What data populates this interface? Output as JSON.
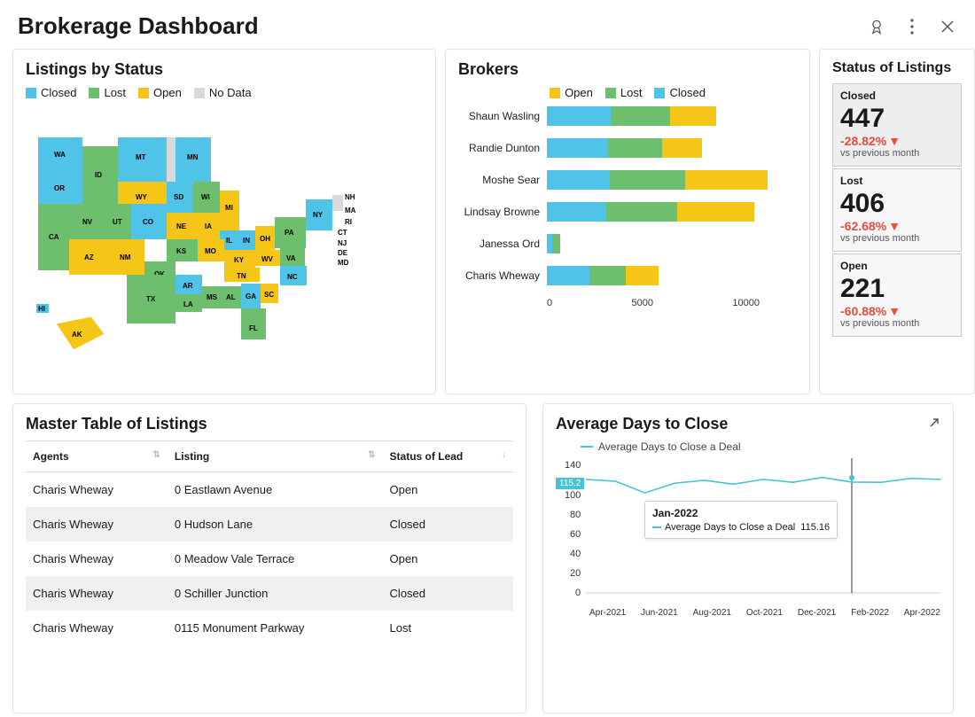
{
  "header": {
    "title": "Brokerage Dashboard"
  },
  "colors": {
    "closed": "#4fc3e8",
    "lost": "#6dbf6d",
    "open": "#f5c518",
    "nodata": "#d9d9d9"
  },
  "map": {
    "title": "Listings by Status",
    "legend": [
      {
        "label": "Closed",
        "color": "#4fc3e8"
      },
      {
        "label": "Lost",
        "color": "#6dbf6d"
      },
      {
        "label": "Open",
        "color": "#f5c518"
      },
      {
        "label": "No Data",
        "color": "#d9d9d9"
      }
    ]
  },
  "brokers": {
    "title": "Brokers",
    "legend": [
      {
        "label": "Open",
        "color": "#f5c518"
      },
      {
        "label": "Lost",
        "color": "#6dbf6d"
      },
      {
        "label": "Closed",
        "color": "#4fc3e8"
      }
    ]
  },
  "chart_data": [
    {
      "type": "bar",
      "title": "Brokers",
      "orientation": "horizontal",
      "stacked": true,
      "xlim": [
        0,
        14000
      ],
      "x_ticks": [
        0,
        5000,
        10000
      ],
      "categories": [
        "Shaun Wasling",
        "Randie Dunton",
        "Moshe Sear",
        "Lindsay Browne",
        "Janessa Ord",
        "Charis Wheway"
      ],
      "series": [
        {
          "name": "Closed",
          "color": "#4fc3e8",
          "values": [
            3900,
            3700,
            3800,
            3600,
            300,
            2600
          ]
        },
        {
          "name": "Lost",
          "color": "#6dbf6d",
          "values": [
            3600,
            3300,
            4600,
            4300,
            500,
            2200
          ]
        },
        {
          "name": "Open",
          "color": "#f5c518",
          "values": [
            2800,
            2400,
            5000,
            4700,
            0,
            2000
          ]
        }
      ]
    },
    {
      "type": "line",
      "title": "Average Days to Close",
      "legend": [
        "Average Days to Close a Deal"
      ],
      "x": [
        "Apr-2021",
        "May-2021",
        "Jun-2021",
        "Jul-2021",
        "Aug-2021",
        "Sep-2021",
        "Oct-2021",
        "Nov-2021",
        "Dec-2021",
        "Jan-2022",
        "Feb-2022",
        "Mar-2022",
        "Apr-2022"
      ],
      "x_ticks": [
        "Apr-2021",
        "Jun-2021",
        "Aug-2021",
        "Oct-2021",
        "Dec-2021",
        "Feb-2022",
        "Apr-2022"
      ],
      "series": [
        {
          "name": "Average Days to Close a Deal",
          "color": "#46c3d4",
          "values": [
            118,
            116,
            104,
            114,
            117,
            113,
            118,
            115,
            120,
            115.16,
            115,
            119,
            118
          ]
        }
      ],
      "ylim": [
        0,
        140
      ],
      "y_ticks": [
        0,
        20,
        40,
        60,
        80,
        100,
        140
      ],
      "callout_value": 115.2,
      "highlight": {
        "x": "Jan-2022",
        "value": 115.16
      }
    }
  ],
  "status": {
    "title": "Status of Listings",
    "items": [
      {
        "label": "Closed",
        "value": "447",
        "delta": "-28.82%",
        "sub": "vs previous month",
        "selected": true
      },
      {
        "label": "Lost",
        "value": "406",
        "delta": "-62.68%",
        "sub": "vs previous month"
      },
      {
        "label": "Open",
        "value": "221",
        "delta": "-60.88%",
        "sub": "vs previous month"
      }
    ]
  },
  "table": {
    "title": "Master Table of Listings",
    "columns": [
      "Agents",
      "Listing",
      "Status of Lead"
    ],
    "rows": [
      {
        "agent": "Charis Wheway",
        "listing": "0 Eastlawn Avenue",
        "status": "Open"
      },
      {
        "agent": "Charis Wheway",
        "listing": "0 Hudson Lane",
        "status": "Closed"
      },
      {
        "agent": "Charis Wheway",
        "listing": "0 Meadow Vale Terrace",
        "status": "Open"
      },
      {
        "agent": "Charis Wheway",
        "listing": "0 Schiller Junction",
        "status": "Closed"
      },
      {
        "agent": "Charis Wheway",
        "listing": "0115 Monument Parkway",
        "status": "Lost"
      }
    ]
  },
  "line": {
    "title": "Average Days to Close",
    "legend": "Average Days to Close a Deal",
    "tooltip": {
      "title": "Jan-2022",
      "label": "Average Days to Close a Deal",
      "value": "115.16"
    }
  }
}
